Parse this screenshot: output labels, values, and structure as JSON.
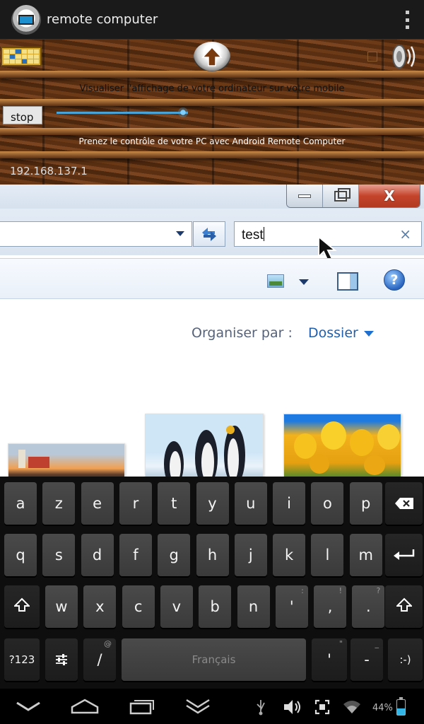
{
  "app": {
    "title": "remote computer"
  },
  "panel": {
    "line1": "Visualiser l'affichage de votre ordinateur sur votre mobile",
    "stop_label": "stop",
    "line2": "Prenez le contrôle de votre PC avec Android Remote Computer",
    "ip": "192.168.137.1",
    "stream_slider_value": 0.96
  },
  "remote_window": {
    "min_label": "",
    "close_label": "X",
    "search_value": "test",
    "clear_label": "×",
    "help_label": "?",
    "organize_label": "Organiser par :",
    "organize_value": "Dossier",
    "thumbnails": [
      "lighthouse",
      "penguins",
      "tulips"
    ]
  },
  "keyboard": {
    "row1": [
      "a",
      "z",
      "e",
      "r",
      "t",
      "y",
      "u",
      "i",
      "o",
      "p"
    ],
    "row2": [
      "q",
      "s",
      "d",
      "f",
      "g",
      "h",
      "j",
      "k",
      "l",
      "m"
    ],
    "row3": [
      "w",
      "x",
      "c",
      "v",
      "b",
      "n",
      "'",
      ",",
      "."
    ],
    "row3_hints": [
      "",
      "",
      "",
      "",
      "",
      "",
      ":",
      "!",
      "?"
    ],
    "row4": {
      "symbols": "?123",
      "slash": "/",
      "slash_hint": "@",
      "space": "Français",
      "apostrophe": "'",
      "apostrophe_hint": "\"",
      "dash": "-",
      "dash_hint": "_",
      "smiley": ":-)"
    },
    "icons": {
      "backspace": "backspace-icon",
      "enter": "enter-icon",
      "shift": "shift-icon",
      "settings": "settings-sliders-icon"
    }
  },
  "statusbar": {
    "battery_percent": "44%",
    "battery_level": 0.44
  },
  "colors": {
    "accent_blue": "#33b5e5",
    "link_blue": "#1f5fae",
    "close_red": "#c4442b"
  }
}
